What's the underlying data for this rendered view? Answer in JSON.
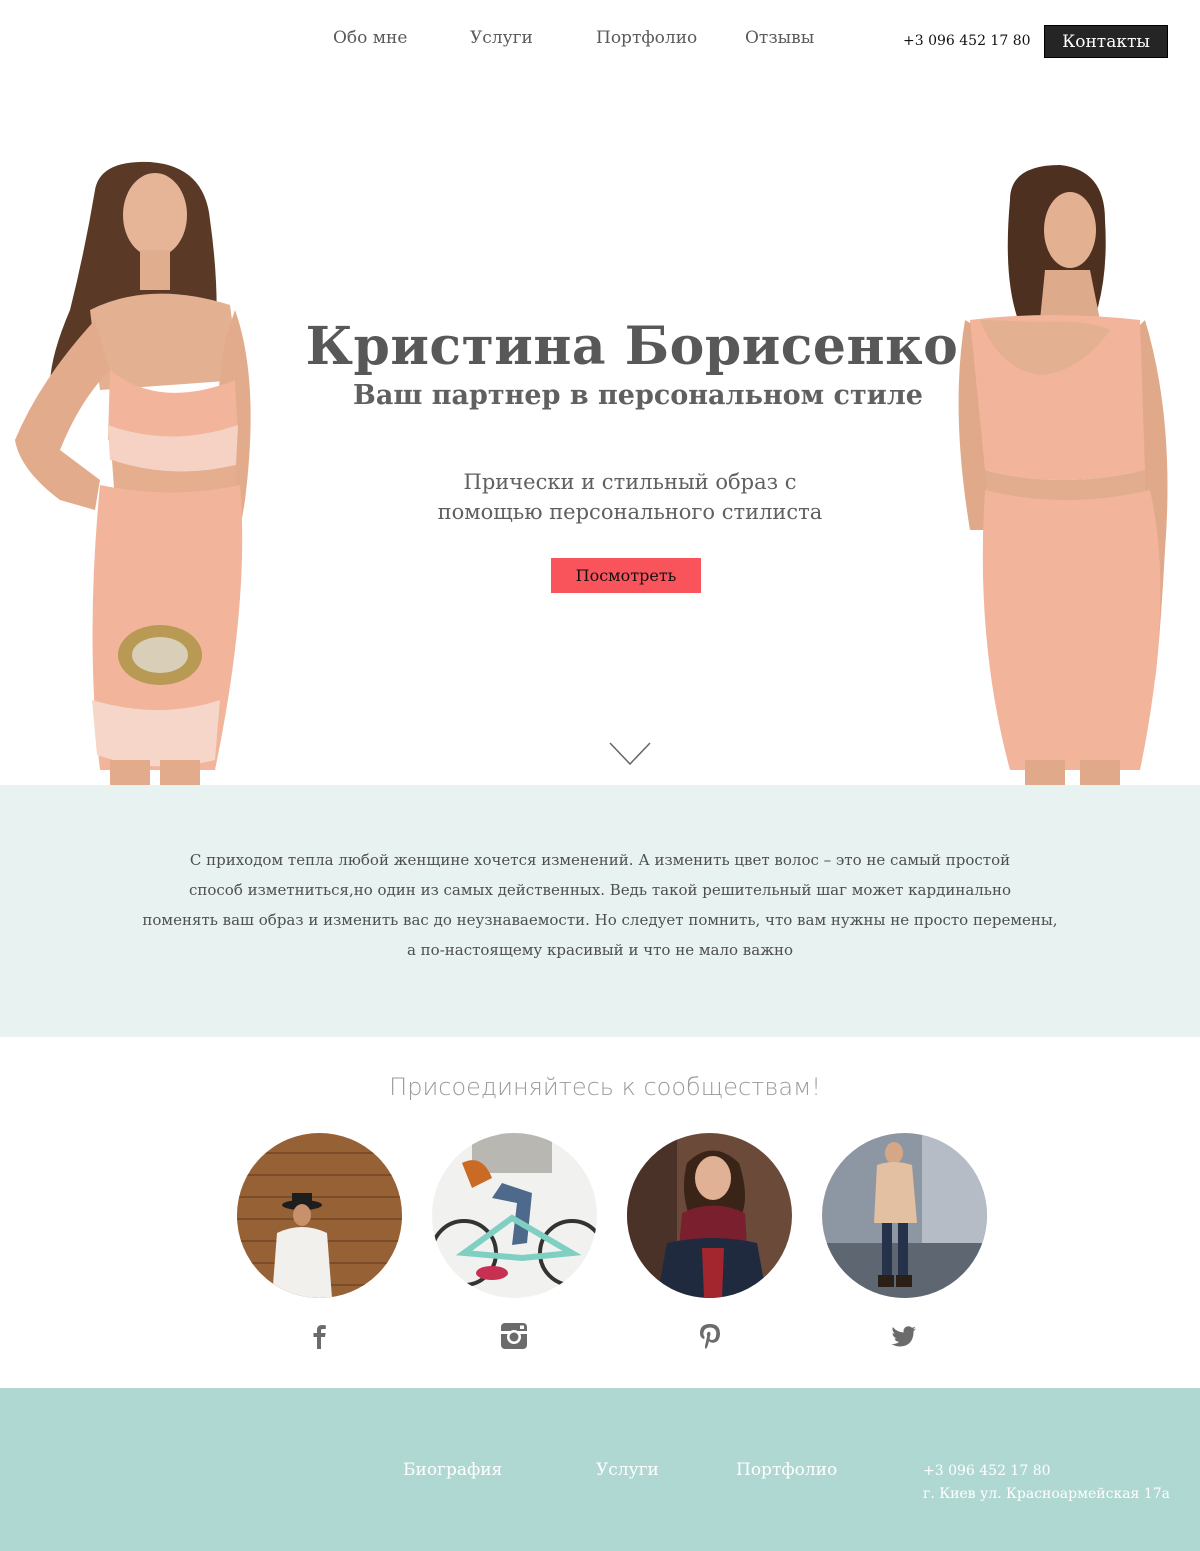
{
  "nav": {
    "items": [
      {
        "label": "Обо мне"
      },
      {
        "label": "Услуги"
      },
      {
        "label": "Портфолио"
      },
      {
        "label": "Отзывы"
      }
    ],
    "phone": "+3 096 452 17 80",
    "contacts_label": "Контакты"
  },
  "hero": {
    "title": "Кристина Борисенко",
    "subtitle": "Ваш партнер в персональном стиле",
    "lead_line_1": "Прически и стильный образ с",
    "lead_line_2": "помощью персонального стилиста",
    "button_label": "Посмотреть",
    "scroll_icon": "chevron-down-icon"
  },
  "intro": {
    "lines": [
      "С приходом тепла любой женщине хочется изменений. А изменить цвет волос – это не самый простой",
      "способ изметниться,но один из самых действенных. Ведь такой решительный шаг может кардинально",
      "поменять ваш образ и изменить вас до неузнаваемости. Но следует помнить, что вам нужны не просто перемены,",
      "а по-настоящему красивый и что не мало важно"
    ]
  },
  "community": {
    "title": "Присоединяйтесь к сообществам!",
    "networks": [
      {
        "icon": "facebook-icon"
      },
      {
        "icon": "instagram-icon"
      },
      {
        "icon": "pinterest-icon"
      },
      {
        "icon": "twitter-icon"
      }
    ]
  },
  "footer": {
    "links": [
      {
        "label": "Биография"
      },
      {
        "label": "Услуги"
      },
      {
        "label": "Портфолио"
      }
    ],
    "phone": "+3 096 452 17 80",
    "address": "г. Киев ул. Красноармейская 17а"
  },
  "colors": {
    "accent_button": "#f9545b",
    "intro_band": "#e7f2f1",
    "footer": "#b0d8d3",
    "contacts_button": "#252525",
    "dress": "#f2b49a"
  }
}
